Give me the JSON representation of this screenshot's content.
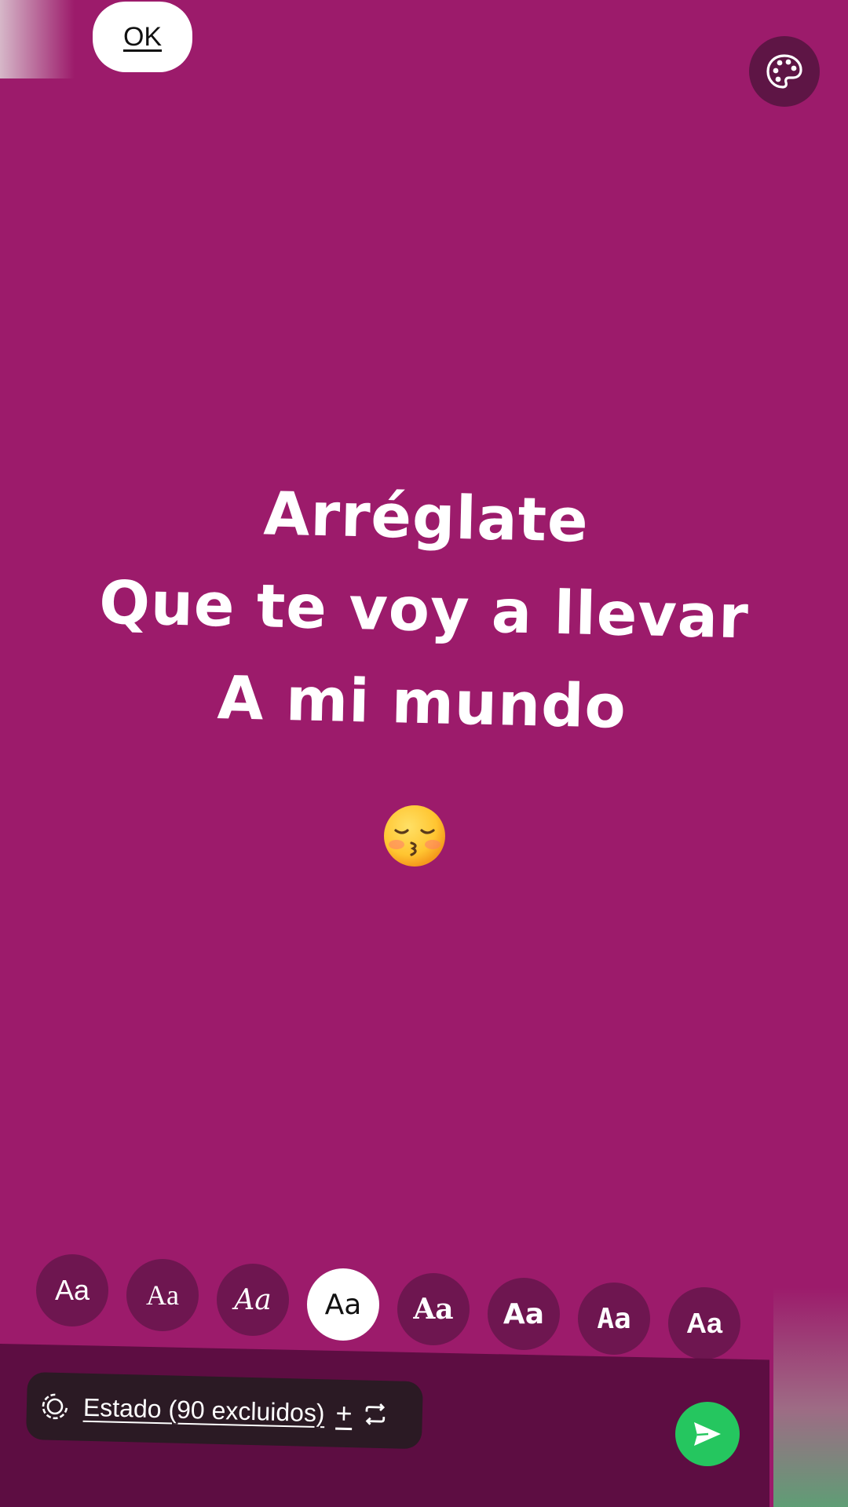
{
  "header": {
    "ok_label": "OK",
    "palette_icon": "palette-icon"
  },
  "status": {
    "lines": [
      "Arréglate",
      "Que te voy a llevar",
      "A mi mundo"
    ],
    "emoji": "kissing-face-with-closed-eyes-emoji",
    "background_color": "#9c1b6b",
    "text_color": "#ffffff"
  },
  "font_picker": {
    "options": [
      {
        "label": "Aa",
        "style": "sans"
      },
      {
        "label": "Aa",
        "style": "serif"
      },
      {
        "label": "Aa",
        "style": "script"
      },
      {
        "label": "Aa",
        "style": "rounded",
        "selected": true
      },
      {
        "label": "Aa",
        "style": "slab-bold"
      },
      {
        "label": "Aa",
        "style": "condensed-bold"
      },
      {
        "label": "Aa",
        "style": "typewriter-bold"
      },
      {
        "label": "Aa",
        "style": "heavy-sans"
      }
    ]
  },
  "footer": {
    "audience_label": "Estado (90 excluidos)",
    "audience_plus": "+",
    "audience_icon": "status-ring-icon",
    "repeat_icon": "repeat-icon",
    "send_icon": "send-icon",
    "send_color": "#25c65f"
  }
}
